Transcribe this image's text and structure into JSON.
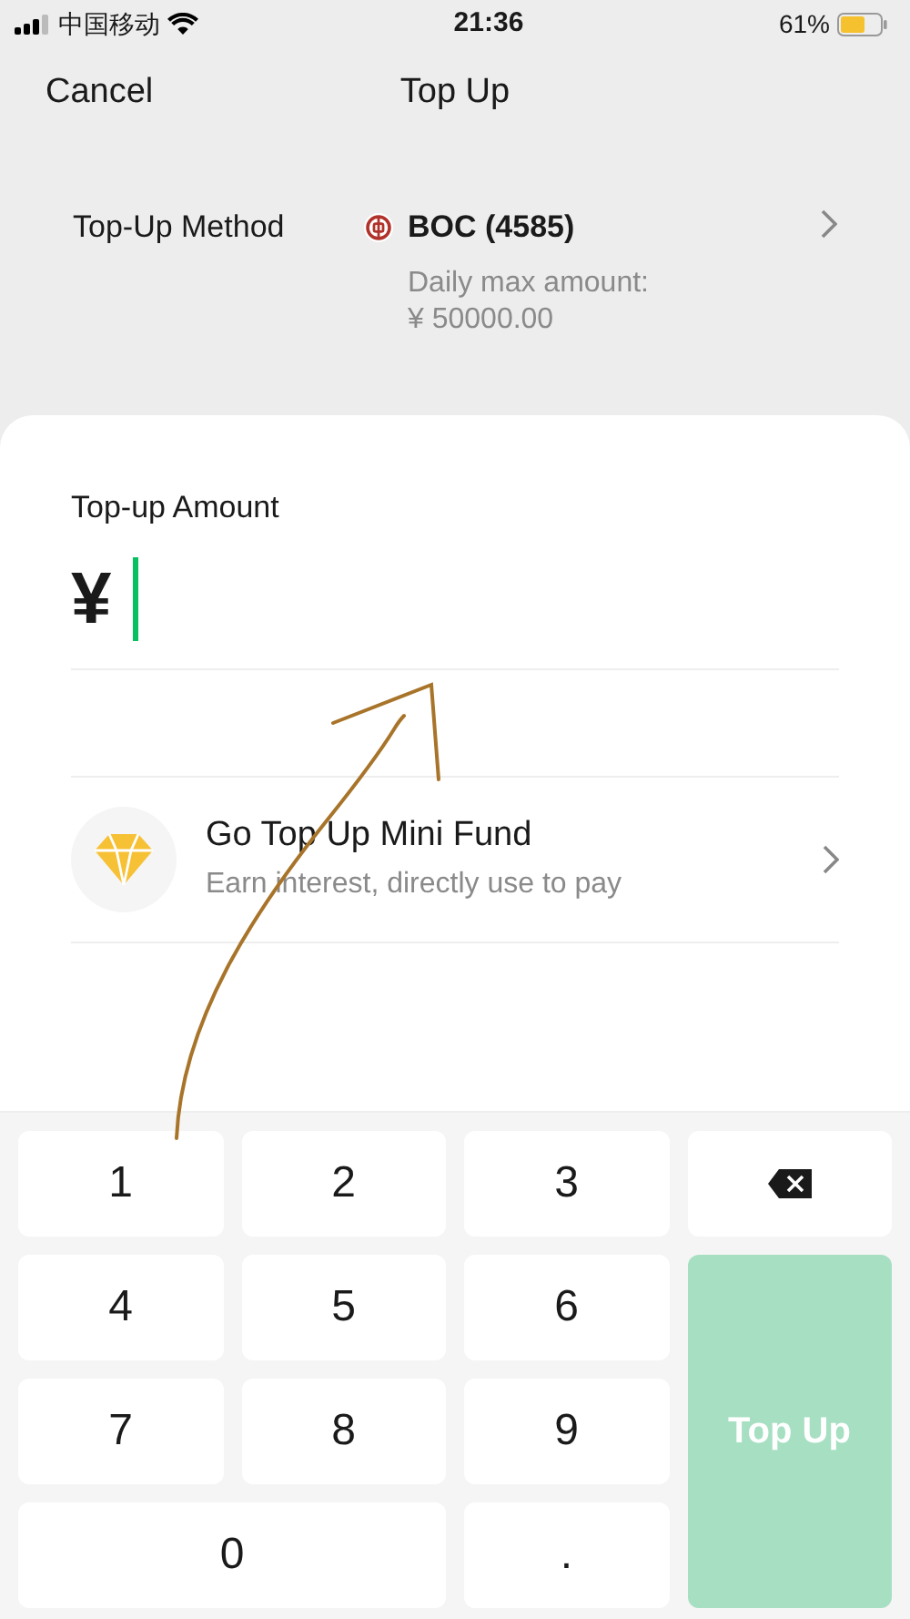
{
  "status_bar": {
    "carrier": "中国移动",
    "time": "21:36",
    "battery": "61%"
  },
  "nav": {
    "cancel": "Cancel",
    "title": "Top Up"
  },
  "method": {
    "label": "Top-Up Method",
    "bank": "BOC (4585)",
    "limit_label": "Daily max amount:",
    "limit_value": "¥ 50000.00"
  },
  "amount": {
    "label": "Top-up Amount",
    "currency": "¥"
  },
  "fund": {
    "title": "Go Top Up Mini Fund",
    "subtitle": "Earn interest, directly use to pay"
  },
  "keypad": [
    {
      "kind": "digit",
      "label": "1"
    },
    {
      "kind": "digit",
      "label": "2"
    },
    {
      "kind": "digit",
      "label": "3"
    },
    {
      "kind": "delete"
    },
    {
      "kind": "digit",
      "label": "4"
    },
    {
      "kind": "digit",
      "label": "5"
    },
    {
      "kind": "digit",
      "label": "6"
    },
    {
      "kind": "digit",
      "label": "7"
    },
    {
      "kind": "digit",
      "label": "8"
    },
    {
      "kind": "digit",
      "label": "9"
    },
    {
      "kind": "submit",
      "label": "Top Up",
      "disabled": true
    },
    {
      "kind": "digit",
      "label": "0"
    },
    {
      "kind": "digit",
      "label": "."
    }
  ]
}
